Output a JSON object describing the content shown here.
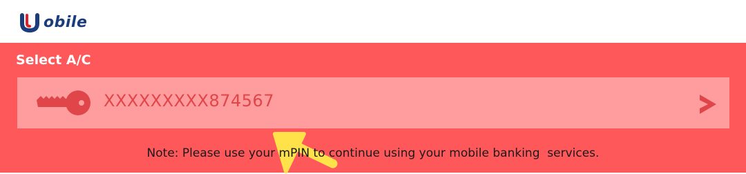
{
  "brand": {
    "logo_text": "obile",
    "logo_letter": "U"
  },
  "account_select": {
    "title": "Select A/C",
    "account_number": "XXXXXXXXX874567",
    "leading_icon": "key-icon",
    "trailing_icon": "chevron-right-icon"
  },
  "annotation": {
    "icon": "arrow-pointer-icon",
    "color": "#ffe14a"
  },
  "note": "Note: Please use your mPIN to continue using your mobile banking  services.",
  "colors": {
    "primary": "#ff585b",
    "row_background": "#ff9d9e",
    "accent_text": "#e04549",
    "brand_blue": "#1b3d7c",
    "brand_red": "#d8232a"
  }
}
